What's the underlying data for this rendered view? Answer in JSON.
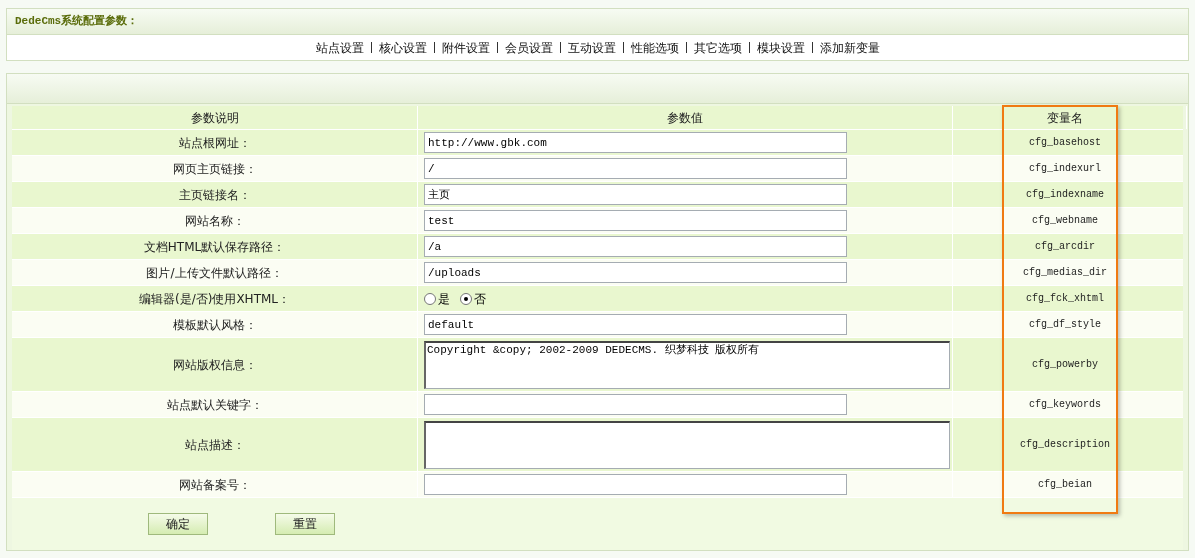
{
  "title": "DedeCms系统配置参数：",
  "nav": [
    "站点设置",
    "核心设置",
    "附件设置",
    "会员设置",
    "互动设置",
    "性能选项",
    "其它选项",
    "模块设置",
    "添加新变量"
  ],
  "columns": [
    {
      "label": "参数说明",
      "highlighted": false
    },
    {
      "label": "参数值",
      "highlighted": false
    },
    {
      "label": "变量名",
      "highlighted": true
    }
  ],
  "rows": [
    {
      "kind": "text",
      "label": "站点根网址：",
      "value": "http://www.gbk.com",
      "variable": "cfg_basehost"
    },
    {
      "kind": "text",
      "label": "网页主页链接：",
      "value": "/",
      "variable": "cfg_indexurl"
    },
    {
      "kind": "text",
      "label": "主页链接名：",
      "value": "主页",
      "variable": "cfg_indexname"
    },
    {
      "kind": "text",
      "label": "网站名称：",
      "value": "test",
      "variable": "cfg_webname"
    },
    {
      "kind": "text",
      "label": "文档HTML默认保存路径：",
      "value": "/a",
      "variable": "cfg_arcdir"
    },
    {
      "kind": "text",
      "label": "图片/上传文件默认路径：",
      "value": "/uploads",
      "variable": "cfg_medias_dir"
    },
    {
      "kind": "radio",
      "label": "编辑器(是/否)使用XHTML：",
      "options": [
        {
          "label": "是",
          "selected": false
        },
        {
          "label": "否",
          "selected": true
        }
      ],
      "variable": "cfg_fck_xhtml"
    },
    {
      "kind": "text",
      "label": "模板默认风格：",
      "value": "default",
      "variable": "cfg_df_style"
    },
    {
      "kind": "textarea",
      "label": "网站版权信息：",
      "value": "Copyright &copy; 2002-2009 DEDECMS. 织梦科技 版权所有",
      "variable": "cfg_powerby"
    },
    {
      "kind": "text",
      "label": "站点默认关键字：",
      "value": "",
      "variable": "cfg_keywords"
    },
    {
      "kind": "textarea",
      "label": "站点描述：",
      "value": "",
      "variable": "cfg_description"
    },
    {
      "kind": "text",
      "label": "网站备案号：",
      "value": "",
      "variable": "cfg_beian"
    }
  ],
  "buttons": [
    "确定",
    "重置"
  ]
}
